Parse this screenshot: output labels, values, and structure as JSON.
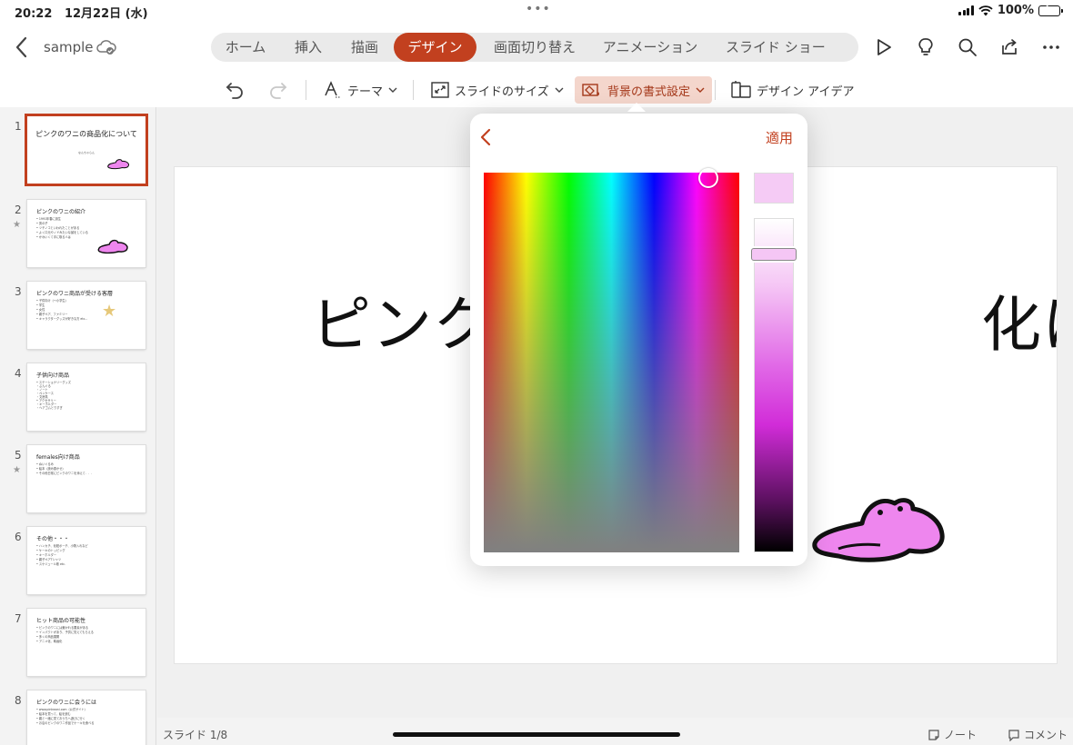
{
  "status_bar": {
    "time": "20:22",
    "date": "12月22日 (水)",
    "dots": "•••",
    "battery": "100%"
  },
  "header": {
    "doc_name": "sample"
  },
  "tabs": [
    {
      "label": "ホーム",
      "active": false
    },
    {
      "label": "挿入",
      "active": false
    },
    {
      "label": "描画",
      "active": false
    },
    {
      "label": "デザイン",
      "active": true
    },
    {
      "label": "画面切り替え",
      "active": false
    },
    {
      "label": "アニメーション",
      "active": false
    },
    {
      "label": "スライド ショー",
      "active": false
    }
  ],
  "toolbar": {
    "theme": "テーマ",
    "slide_size": "スライドのサイズ",
    "background_format": "背景の書式設定",
    "design_ideas": "デザイン アイデア"
  },
  "popover": {
    "apply": "適用",
    "selected_color": "#f5cbf5",
    "colors": {
      "accent": "#c2401f"
    }
  },
  "slides": [
    {
      "number": "1",
      "title": "ピンクのワニの商品化について",
      "subtitle": "なんちゃらん",
      "starred": false
    },
    {
      "number": "2",
      "title": "ピンクのワニの紹介",
      "lines": [
        "• 1991年春に誕生",
        "• 男の子",
        "• ツチノコといわれたことがある",
        "• よく口元やノドみたいな顔をしている",
        "• かわいくて手に取る人は"
      ],
      "starred": true
    },
    {
      "number": "3",
      "title": "ピンクのワニ商品が受ける客層",
      "lines": [
        "• 子供向け（～小学生）",
        "• 学生",
        "• 女性",
        "• 親子ペア、ファミリー",
        "• キャラクターグッズが好きな方 etc..."
      ],
      "starred": false
    },
    {
      "number": "4",
      "title": "子供向け商品",
      "lines": [
        "• ステーショナリーグッズ",
        "    ・ぶんぐる",
        "    ・ノート",
        "    ・ペンケース",
        "    ・文房具",
        "• アクセサリー",
        "    ・キーホルダー",
        "    ・ヘアゴムとりすぎ"
      ],
      "starred": false
    },
    {
      "number": "5",
      "title": "females向け商品",
      "lines": [
        "• ぬいぐるみ",
        "• 絵本（読み聞かせ）",
        "• その他日常にピンクのワニを添えて．．．"
      ],
      "starred": true
    },
    {
      "number": "6",
      "title": "その他・・・",
      "lines": [
        "• ハンカチ、化粧ポーチ、小物入れなど",
        "• ケーキのトッピング",
        "• キーホルダー",
        "• 親子ペアTシャツ",
        "• スケジュール帳 etc."
      ],
      "starred": false
    },
    {
      "number": "7",
      "title": "ヒット商品の可能性",
      "lines": [
        "• ピンクのワニには魅かれる要素がある",
        "• インパクトがあり、子供に覚えてもらえる",
        "• 多くの商品展開",
        "• アニメ化、映画化"
      ],
      "starred": false
    },
    {
      "number": "8",
      "title": "ピンクのワニに会うには",
      "lines": [
        "• www.pinkwani.com（公式サイト）",
        "• 絵本を買って、絵を読む",
        "• 親と一緒に見ておうちへ遊びに行く",
        "• お店のピンクのワニ作品でケーキを食べる"
      ],
      "starred": false
    }
  ],
  "main_slide": {
    "title_visible": "ピンク　　　　　　　　化に"
  },
  "bottom": {
    "slide_counter": "スライド 1/8",
    "notes": "ノート",
    "comments": "コメント"
  }
}
